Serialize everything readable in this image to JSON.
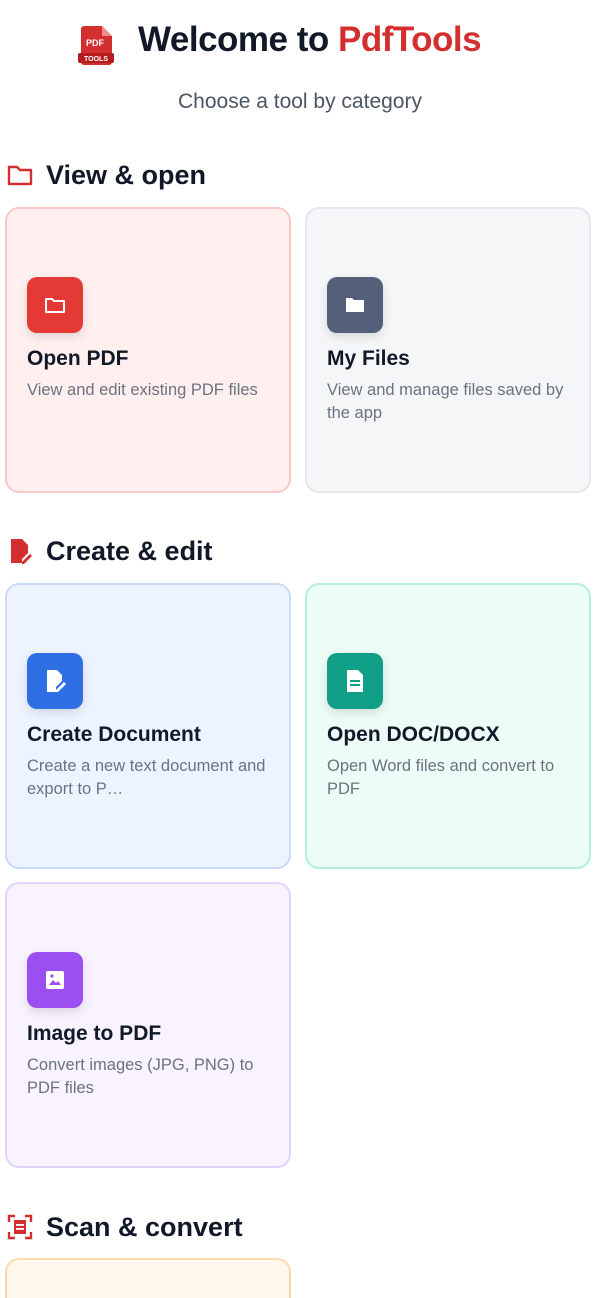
{
  "header": {
    "logo_text_top": "PDF",
    "logo_text_bottom": "TOOLS",
    "welcome_prefix": "Welcome to ",
    "brand": "PdfTools",
    "subtitle": "Choose a tool by category"
  },
  "sections": [
    {
      "title": "View & open",
      "icon": "folder-outline-icon",
      "cards": [
        {
          "title": "Open PDF",
          "desc": "View and edit existing PDF files",
          "icon": "folder-icon",
          "accent": "#e53935"
        },
        {
          "title": "My Files",
          "desc": "View and manage files saved by the app",
          "icon": "folder-icon",
          "accent": "#546079"
        }
      ]
    },
    {
      "title": "Create & edit",
      "icon": "edit-document-icon",
      "cards": [
        {
          "title": "Create Document",
          "desc": "Create a new text document and export to P…",
          "icon": "edit-document-icon",
          "accent": "#2f6fe4"
        },
        {
          "title": "Open DOC/DOCX",
          "desc": "Open Word files and convert to PDF",
          "icon": "document-icon",
          "accent": "#129f88"
        },
        {
          "title": "Image to PDF",
          "desc": "Convert images (JPG, PNG) to PDF files",
          "icon": "image-icon",
          "accent": "#9b4ff0"
        }
      ]
    },
    {
      "title": "Scan & convert",
      "icon": "scan-icon",
      "cards": []
    }
  ],
  "colors": {
    "brand": "#d32f2f",
    "section_icon": "#d32f2f"
  }
}
